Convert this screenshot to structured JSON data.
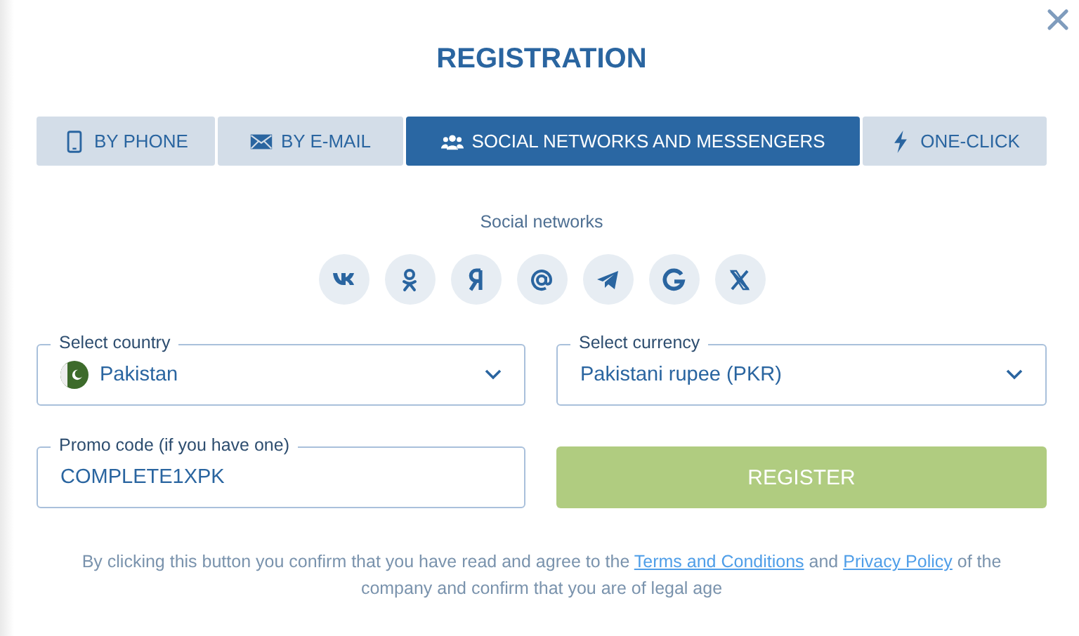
{
  "dialog": {
    "title": "REGISTRATION"
  },
  "tabs": [
    {
      "label": "BY PHONE",
      "kind": "phone",
      "selected": false
    },
    {
      "label": "BY E-MAIL",
      "kind": "mail",
      "selected": false
    },
    {
      "label": "SOCIAL NETWORKS AND MESSENGERS",
      "kind": "people",
      "selected": true
    },
    {
      "label": "ONE-CLICK",
      "kind": "bolt",
      "selected": false
    }
  ],
  "social": {
    "heading": "Social networks",
    "networks": [
      {
        "kind": "vk"
      },
      {
        "kind": "ok"
      },
      {
        "kind": "ya"
      },
      {
        "kind": "mail"
      },
      {
        "kind": "telegram"
      },
      {
        "kind": "google"
      },
      {
        "kind": "x"
      }
    ]
  },
  "country": {
    "label": "Select country",
    "value": "Pakistan"
  },
  "currency": {
    "label": "Select currency",
    "value": "Pakistani rupee (PKR)"
  },
  "promo": {
    "label": "Promo code (if you have one)",
    "value": "COMPLETE1XPK"
  },
  "register_button": {
    "label": "REGISTER",
    "disabled": true
  },
  "consent": [
    {
      "kind": "text",
      "text": "By clicking this button you confirm that you have read and agree to the "
    },
    {
      "kind": "link",
      "text": "Terms and Conditions"
    },
    {
      "kind": "text",
      "text": " and "
    },
    {
      "kind": "link",
      "text": "Privacy Policy"
    },
    {
      "kind": "text",
      "text": " of the company and confirm that you are of legal age"
    }
  ]
}
